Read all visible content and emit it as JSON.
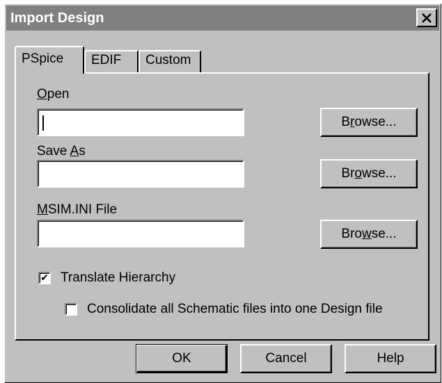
{
  "window": {
    "title": "Import Design",
    "close_glyph": "✕"
  },
  "tabs": [
    {
      "label": "PSpice",
      "active": true
    },
    {
      "label": "EDIF",
      "active": false
    },
    {
      "label": "Custom",
      "active": false
    }
  ],
  "form": {
    "open": {
      "label_mnemonic": "O",
      "label_rest": "pen",
      "value": "",
      "browse_pre": "B",
      "browse_mnemonic": "r",
      "browse_post": "owse..."
    },
    "save_as": {
      "label_pre": "Save ",
      "label_mnemonic": "A",
      "label_post": "s",
      "value": "",
      "browse_pre": "Br",
      "browse_mnemonic": "o",
      "browse_post": "wse..."
    },
    "msim_ini": {
      "label_mnemonic": "M",
      "label_rest": "SIM.INI File",
      "value": "",
      "browse_pre": "Bro",
      "browse_mnemonic": "w",
      "browse_post": "se..."
    },
    "translate_hierarchy": {
      "label": "Translate Hierarchy",
      "checked": true,
      "check_glyph": "✔"
    },
    "consolidate": {
      "label": "Consolidate all Schematic files into one Design file",
      "checked": false
    }
  },
  "buttons": {
    "ok": "OK",
    "cancel": "Cancel",
    "help": "Help"
  },
  "colors": {
    "dialog_bg": "#c0c0c0",
    "titlebar_bg": "#808080",
    "title_text": "#ffffff"
  }
}
